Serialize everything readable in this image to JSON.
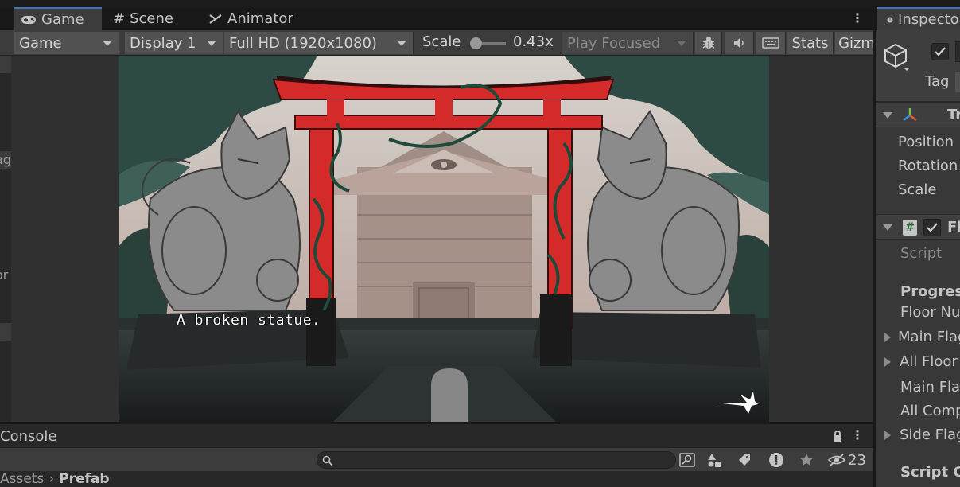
{
  "tabs": {
    "game": "Game",
    "scene": "Scene",
    "animator": "Animator"
  },
  "toolbar": {
    "game_view": "Game",
    "display": "Display 1",
    "resolution": "Full HD (1920x1080)",
    "scale_label": "Scale",
    "scale_value": "0.43x",
    "play_mode": "Play Focused",
    "stats": "Stats",
    "gizmos": "Gizmos"
  },
  "left_strip": {
    "text_a": "ag",
    "text_b": "or"
  },
  "game": {
    "dialog": "A broken statue."
  },
  "console": {
    "title": "Console",
    "hidden_count": "23"
  },
  "breadcrumb": [
    "Assets",
    "Prefab"
  ],
  "inspector": {
    "tab": "Inspector",
    "tag_label": "Tag",
    "transform": {
      "title": "Transform",
      "props": [
        "Position",
        "Rotation",
        "Scale"
      ]
    },
    "script_component": {
      "title": "FloorManager",
      "script_label": "Script",
      "section": "Progress",
      "fields": [
        "Floor Number",
        "Main Flags",
        "All Floor Flags",
        "Main Flags",
        "All Completed",
        "Side Flags"
      ],
      "footer": "Script Components"
    }
  },
  "colors": {
    "accent": "#3a79bb",
    "torii": "#d42a2a",
    "panel": "#383838"
  }
}
